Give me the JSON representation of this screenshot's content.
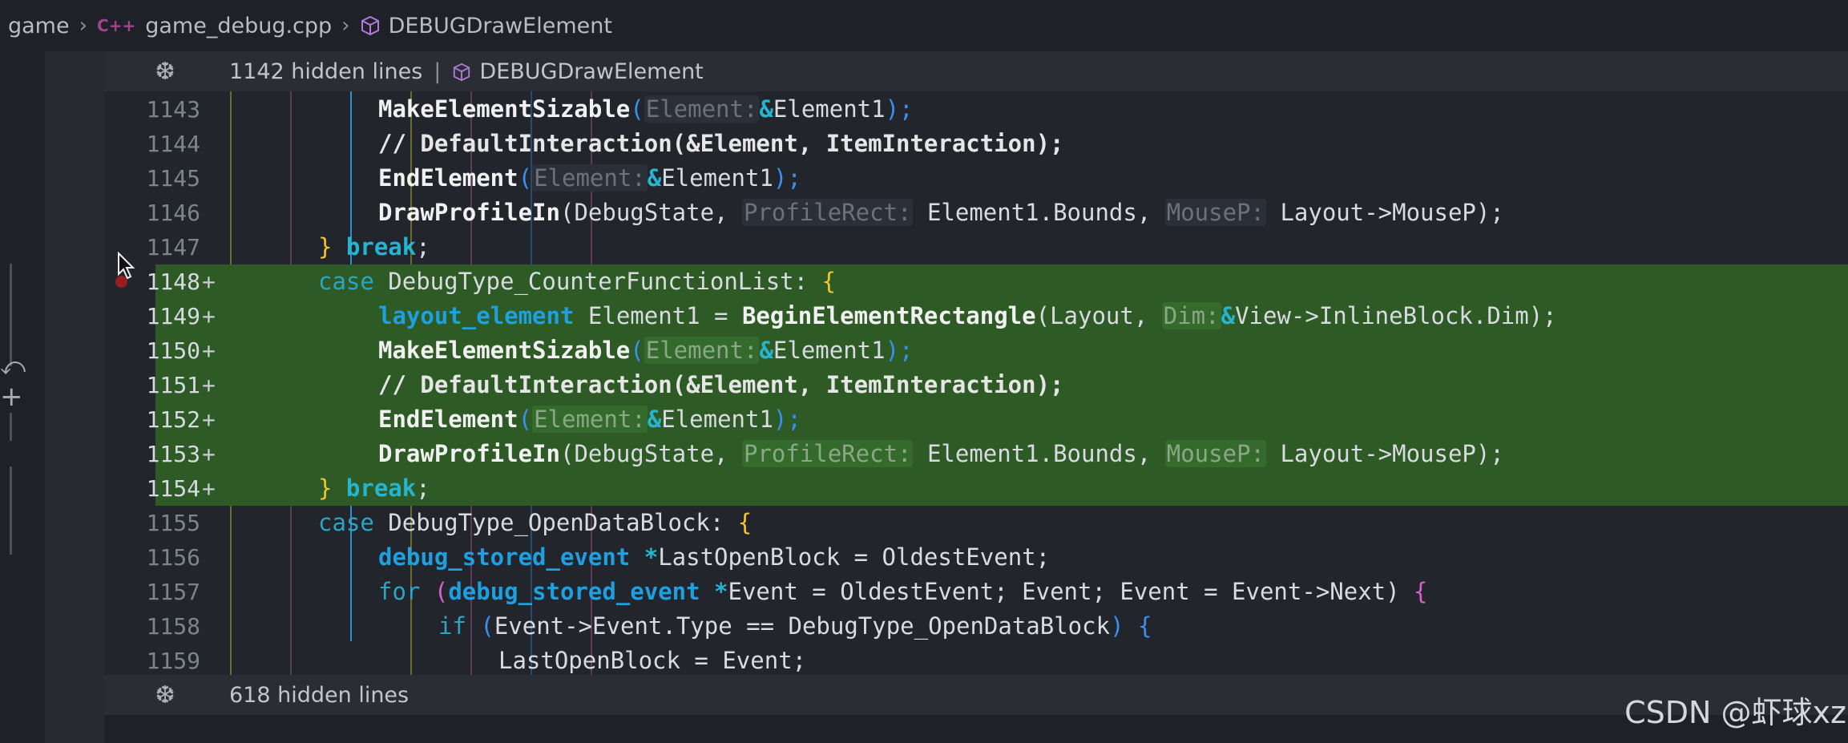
{
  "breadcrumb": {
    "folder": "game",
    "file_lang_icon": "C++",
    "file": "game_debug.cpp",
    "symbol": "DEBUGDrawElement"
  },
  "fold_top": {
    "text": "1142 hidden lines",
    "symbol": "DEBUGDrawElement"
  },
  "fold_bottom": {
    "text": "618 hidden lines"
  },
  "watermark": "CSDN @虾球xz",
  "colors": {
    "added_line": "#2d5a25",
    "keyword": "#27b4cf",
    "type": "#1e9fe0",
    "breakpoint": "#9b1d1d"
  },
  "lines": [
    {
      "no": "1143",
      "added": false
    },
    {
      "no": "1144",
      "added": false
    },
    {
      "no": "1145",
      "added": false
    },
    {
      "no": "1146",
      "added": false
    },
    {
      "no": "1147",
      "added": false
    },
    {
      "no": "1148",
      "added": true
    },
    {
      "no": "1149",
      "added": true
    },
    {
      "no": "1150",
      "added": true
    },
    {
      "no": "1151",
      "added": true
    },
    {
      "no": "1152",
      "added": true
    },
    {
      "no": "1153",
      "added": true
    },
    {
      "no": "1154",
      "added": true
    },
    {
      "no": "1155",
      "added": false
    },
    {
      "no": "1156",
      "added": false
    },
    {
      "no": "1157",
      "added": false
    },
    {
      "no": "1158",
      "added": false
    },
    {
      "no": "1159",
      "added": false
    }
  ],
  "code": {
    "l1143": [
      "MakeElementSizable",
      "(",
      "Element:",
      "&",
      "Element1",
      ");"
    ],
    "l1144": [
      "// DefaultInteraction(&Element, ItemInteraction);"
    ],
    "l1145": [
      "EndElement",
      "(",
      "Element:",
      "&",
      "Element1",
      ");"
    ],
    "l1146": [
      "DrawProfileIn",
      "(DebugState, ",
      "ProfileRect:",
      " Element1.Bounds, ",
      "MouseP:",
      " Layout->MouseP);"
    ],
    "l1147": [
      "}",
      " break",
      ";"
    ],
    "l1148": [
      "case",
      " DebugType_CounterFunctionList: ",
      "{"
    ],
    "l1149": [
      "layout_element",
      " Element1 = ",
      "BeginElementRectangle",
      "(Layout, ",
      "Dim:",
      "&",
      "View->InlineBlock.Dim);"
    ],
    "l1150": [
      "MakeElementSizable",
      "(",
      "Element:",
      "&",
      "Element1",
      ");"
    ],
    "l1151": [
      "// DefaultInteraction(&Element, ItemInteraction);"
    ],
    "l1152": [
      "EndElement",
      "(",
      "Element:",
      "&",
      "Element1",
      ");"
    ],
    "l1153": [
      "DrawProfileIn",
      "(DebugState, ",
      "ProfileRect:",
      " Element1.Bounds, ",
      "MouseP:",
      " Layout->MouseP);"
    ],
    "l1154": [
      "}",
      " break",
      ";"
    ],
    "l1155": [
      "case",
      " DebugType_OpenDataBlock: ",
      "{"
    ],
    "l1156": [
      "debug_stored_event",
      " *",
      "LastOpenBlock = OldestEvent;"
    ],
    "l1157": [
      "for",
      " (",
      "debug_stored_event",
      " *",
      "Event = OldestEvent; Event; Event = Event->Next) ",
      "{"
    ],
    "l1158": [
      "if",
      " (",
      "Event->Event.Type == DebugType_OpenDataBlock",
      ") ",
      "{"
    ],
    "l1159": [
      "LastOpenBlock = Event;"
    ]
  }
}
